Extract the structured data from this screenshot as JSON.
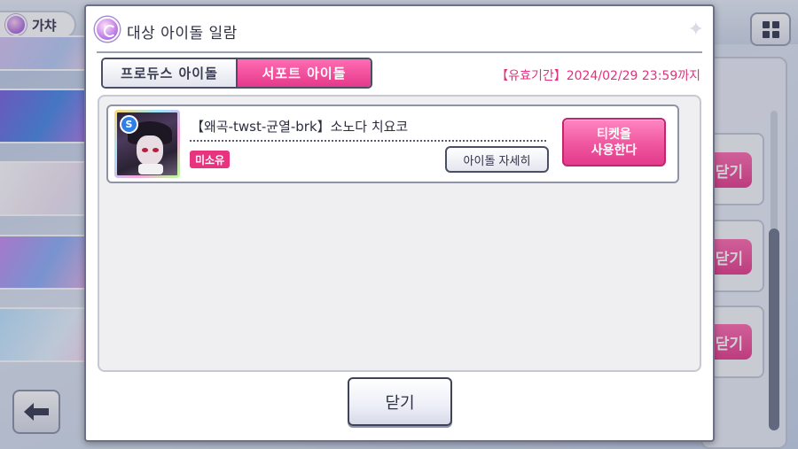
{
  "background": {
    "screen_title": "가챠",
    "side_button_label": "닫기"
  },
  "modal": {
    "title": "대상 아이돌 일람",
    "tabs": [
      {
        "label": "프로듀스 아이돌",
        "selected": false
      },
      {
        "label": "서포트 아이돌",
        "selected": true
      }
    ],
    "validity": "【유효기간】2024/02/29 23:59까지",
    "items": [
      {
        "name": "【왜곡-twst-균열-brk】소노다 치요코",
        "badge_letter": "S",
        "status_badge": "미소유",
        "detail_label": "아이돌 자세히",
        "use_label": "티켓을\n사용한다"
      }
    ],
    "close_label": "닫기"
  },
  "colors": {
    "accent_pink": "#e5388b",
    "validity_text": "#e4307d",
    "support_badge_blue": "#2f7fe6"
  }
}
